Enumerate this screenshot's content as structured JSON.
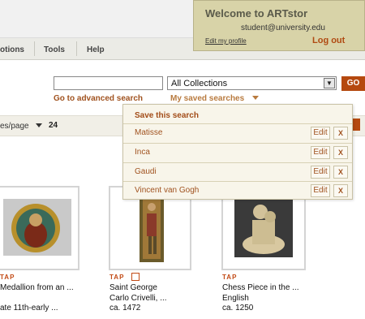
{
  "menu": {
    "options": "otions",
    "tools": "Tools",
    "help": "Help"
  },
  "welcome": {
    "title": "Welcome to ARTstor",
    "email": "student@university.edu",
    "edit_profile": "Edit my profile",
    "logout": "Log out"
  },
  "search": {
    "query": "",
    "collection": "All Collections",
    "go": "GO",
    "advanced": "Go to advanced search",
    "saved": "My saved searches"
  },
  "pager": {
    "per_page_label": "es/page",
    "per_page_value": "24"
  },
  "saved_dropdown": {
    "header": "Save this search",
    "edit_label": "Edit",
    "delete_label": "X",
    "items": [
      "Matisse",
      "Inca",
      "Gaudi",
      "Vincent van Gogh"
    ]
  },
  "results": [
    {
      "badge": "TAP",
      "title": "Medallion from an ...",
      "creator": "",
      "date": "ate 11th-early ..."
    },
    {
      "badge": "TAP",
      "title": "Saint George",
      "creator": "Carlo Crivelli, ...",
      "date": "ca. 1472"
    },
    {
      "badge": "TAP",
      "title": "Chess Piece in the ...",
      "creator": "English",
      "date": "ca. 1250"
    }
  ]
}
